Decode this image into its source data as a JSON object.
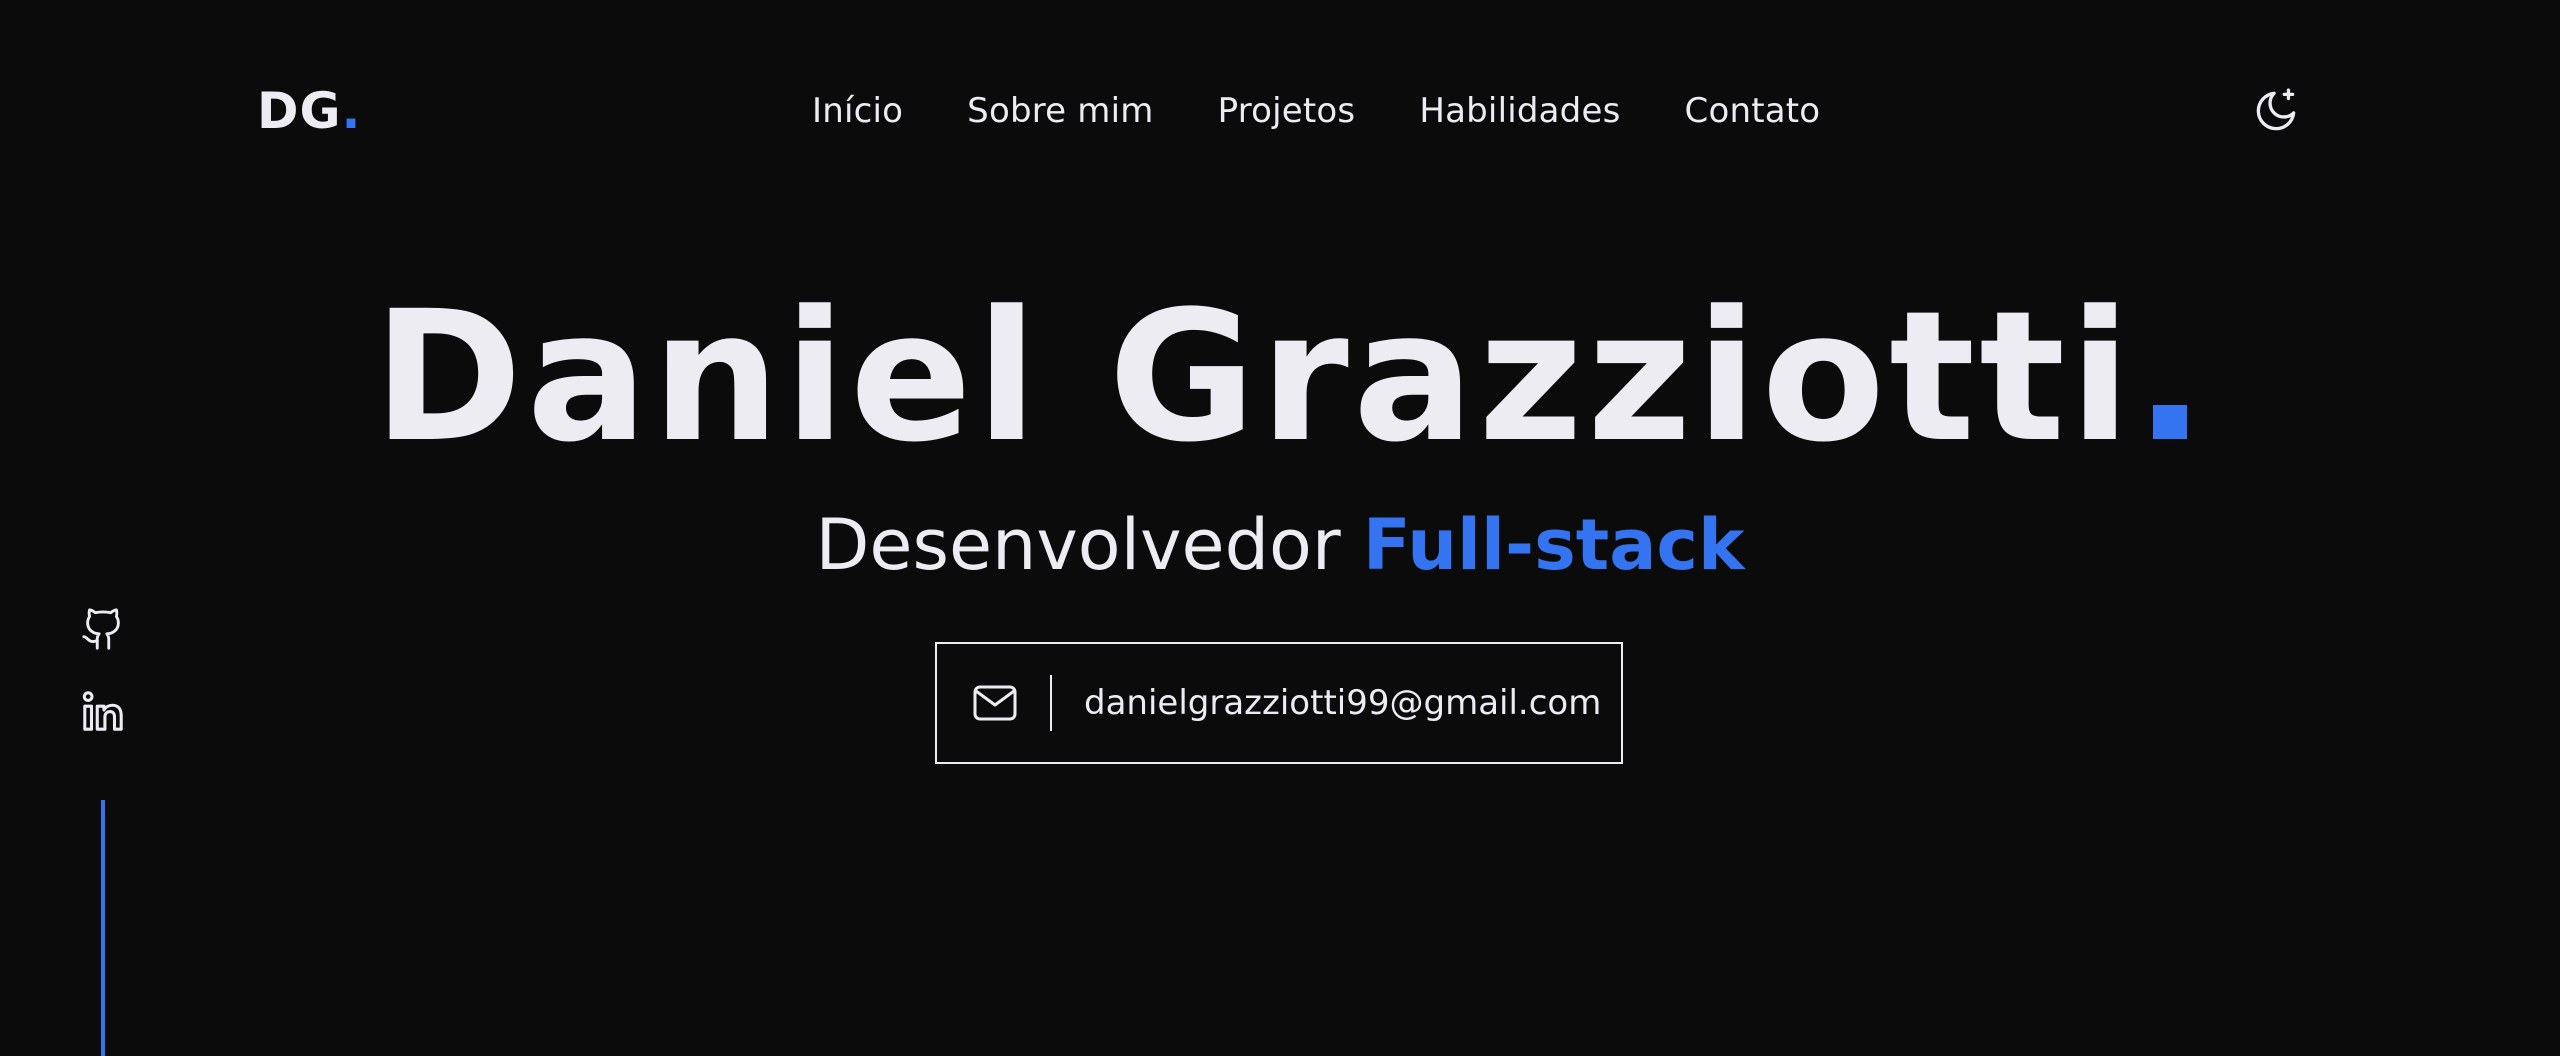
{
  "header": {
    "logo_text": "DG",
    "logo_dot": ".",
    "nav": [
      {
        "label": "Início"
      },
      {
        "label": "Sobre mim"
      },
      {
        "label": "Projetos"
      },
      {
        "label": "Habilidades"
      },
      {
        "label": "Contato"
      }
    ],
    "theme_toggle_icon": "moon-star-icon"
  },
  "hero": {
    "name": "Daniel Grazziotti",
    "role_prefix": "Desenvolvedor",
    "role_highlight": "Full-stack",
    "email_icon": "mail-icon",
    "email": "danielgrazziotti99@gmail.com"
  },
  "social": {
    "items": [
      {
        "icon": "github-icon"
      },
      {
        "icon": "linkedin-icon"
      }
    ]
  },
  "colors": {
    "background": "#0b0b0c",
    "text": "#ececf2",
    "accent": "#3574f0"
  }
}
